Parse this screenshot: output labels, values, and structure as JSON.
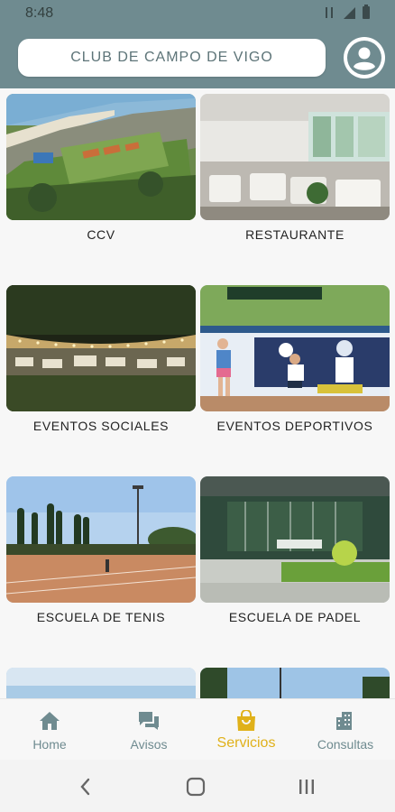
{
  "status_bar": {
    "time": "8:48"
  },
  "header": {
    "title": "CLUB DE CAMPO DE VIGO"
  },
  "cards": [
    {
      "label": "CCV"
    },
    {
      "label": "RESTAURANTE"
    },
    {
      "label": "EVENTOS SOCIALES"
    },
    {
      "label": "EVENTOS DEPORTIVOS"
    },
    {
      "label": "ESCUELA DE TENIS"
    },
    {
      "label": "ESCUELA DE PADEL"
    }
  ],
  "bottom_nav": {
    "items": [
      {
        "label": "Home",
        "icon": "home-icon"
      },
      {
        "label": "Avisos",
        "icon": "chat-icon"
      },
      {
        "label": "Servicios",
        "icon": "shopping-bag-icon",
        "active": true
      },
      {
        "label": "Consultas",
        "icon": "building-icon"
      }
    ]
  },
  "colors": {
    "header": "#6f8b90",
    "active": "#e0b11a",
    "inactive": "#6f8b90"
  }
}
